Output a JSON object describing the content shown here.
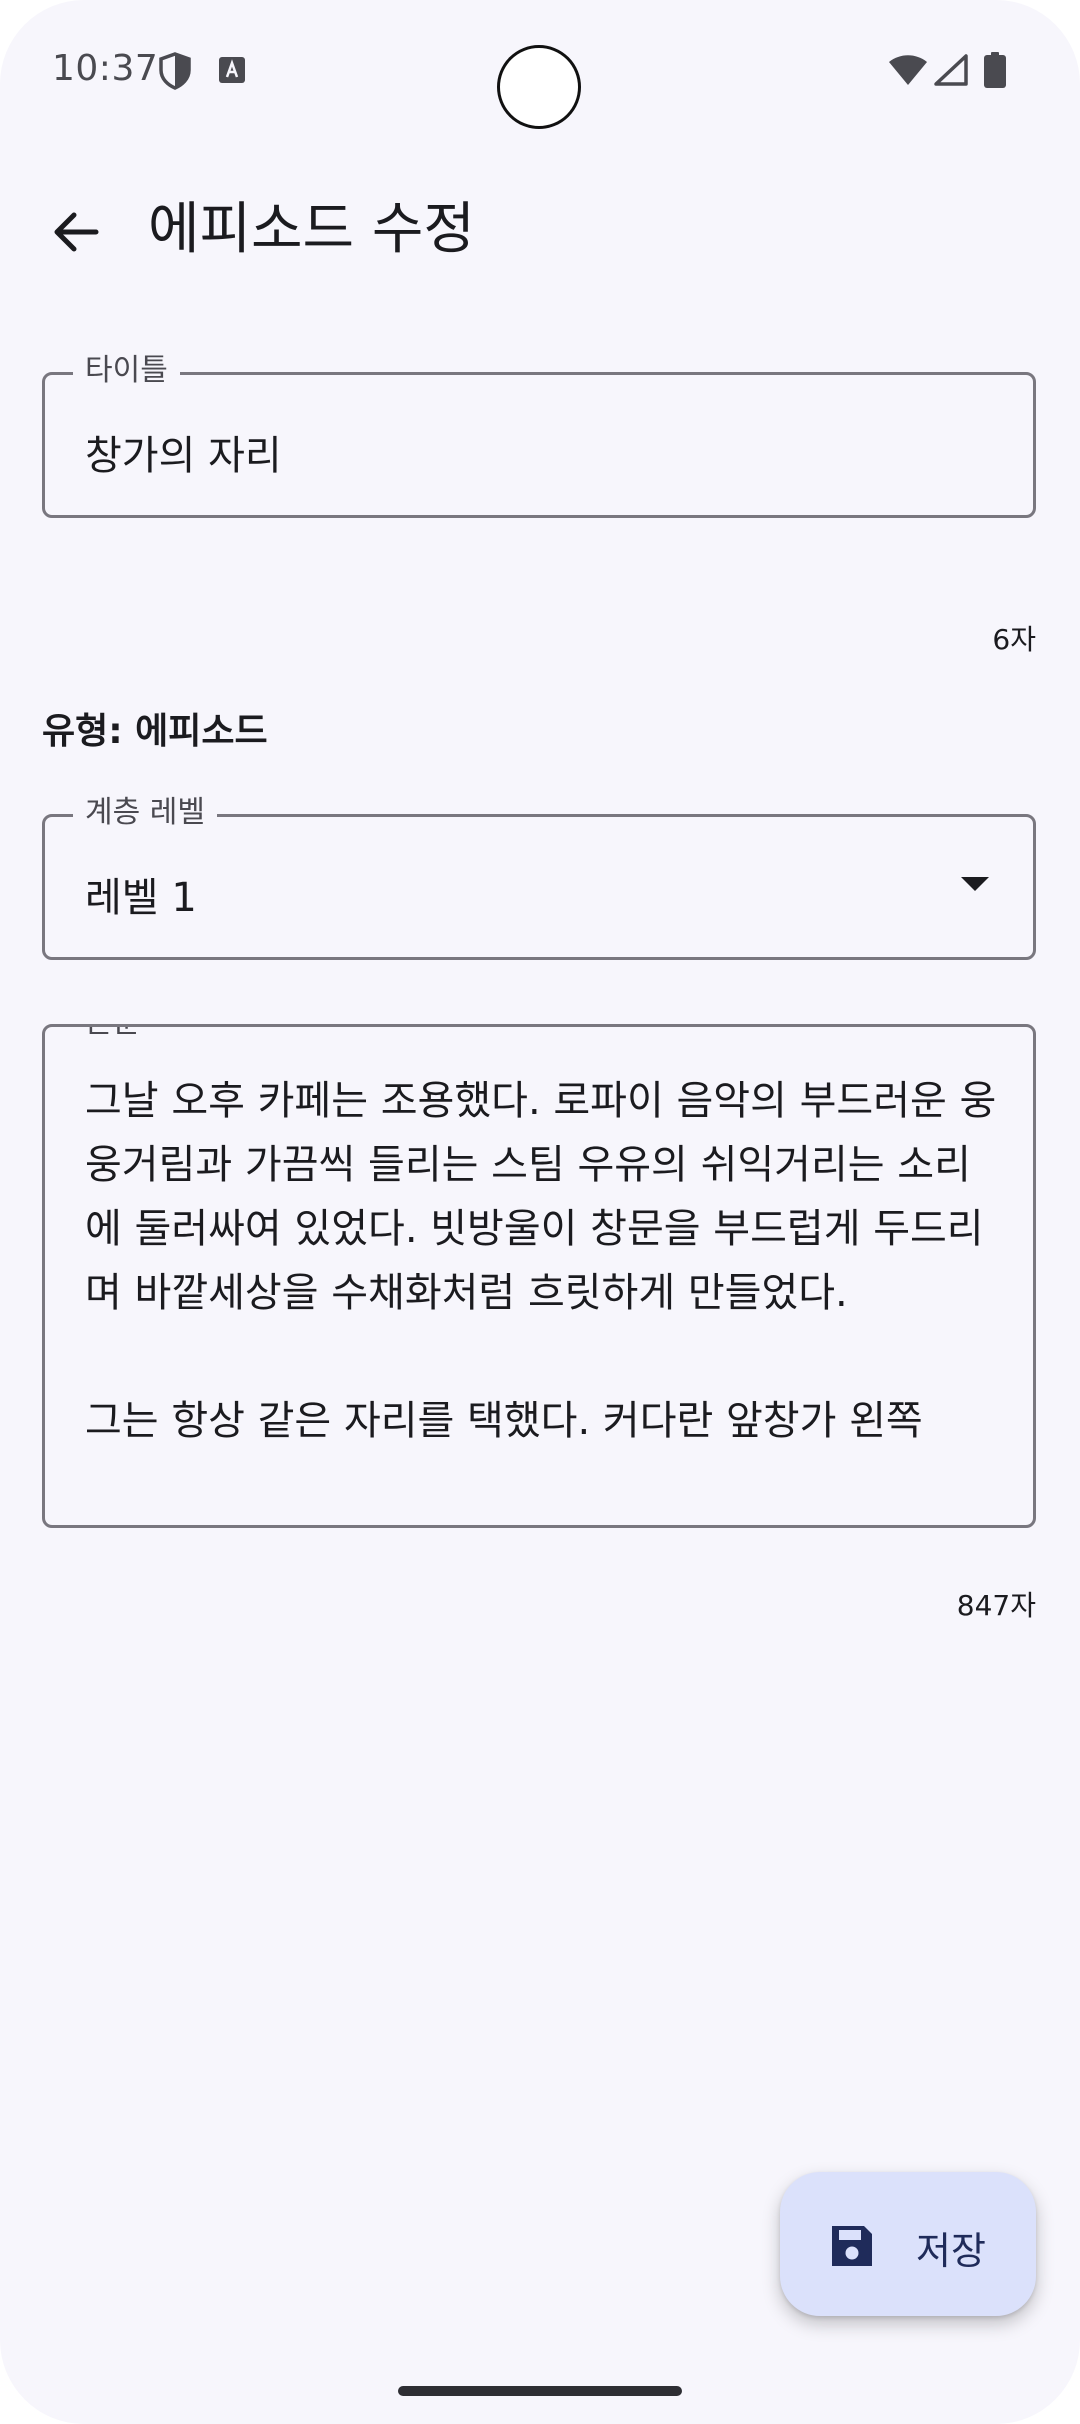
{
  "status_bar": {
    "time": "10:37",
    "icons": [
      "shield-icon",
      "text-a-icon",
      "wifi-icon",
      "signal-icon",
      "battery-icon"
    ]
  },
  "app_bar": {
    "back_icon": "arrow-left-icon",
    "title": "에피소드 수정"
  },
  "form": {
    "title_field": {
      "label": "타이틀",
      "value": "창가의 자리",
      "counter": "6자"
    },
    "type": "유형: 에피소드",
    "level_field": {
      "label": "계층 레벨",
      "value": "레벨 1",
      "icon": "dropdown-arrow-icon"
    },
    "body_field": {
      "label": "본문",
      "value": "그날 오후 카페는 조용했다. 로파이 음악의 부드러운 웅웅거림과 가끔씩 들리는 스팀 우유의 쉬익거리는 소리에 둘러싸여 있었다. 빗방울이 창문을 부드럽게 두드리며 바깥세상을 수채화처럼 흐릿하게 만들었다.\n\n그는 항상 같은 자리를 택했다. 커다란 앞창가 왼쪽",
      "counter": "847자"
    }
  },
  "fab": {
    "icon": "save-icon",
    "label": "저장"
  },
  "colors": {
    "background": "#f7f6fc",
    "outline": "#79777f",
    "fab_container": "#dbe1fb",
    "fab_content": "#1f2b5a"
  }
}
